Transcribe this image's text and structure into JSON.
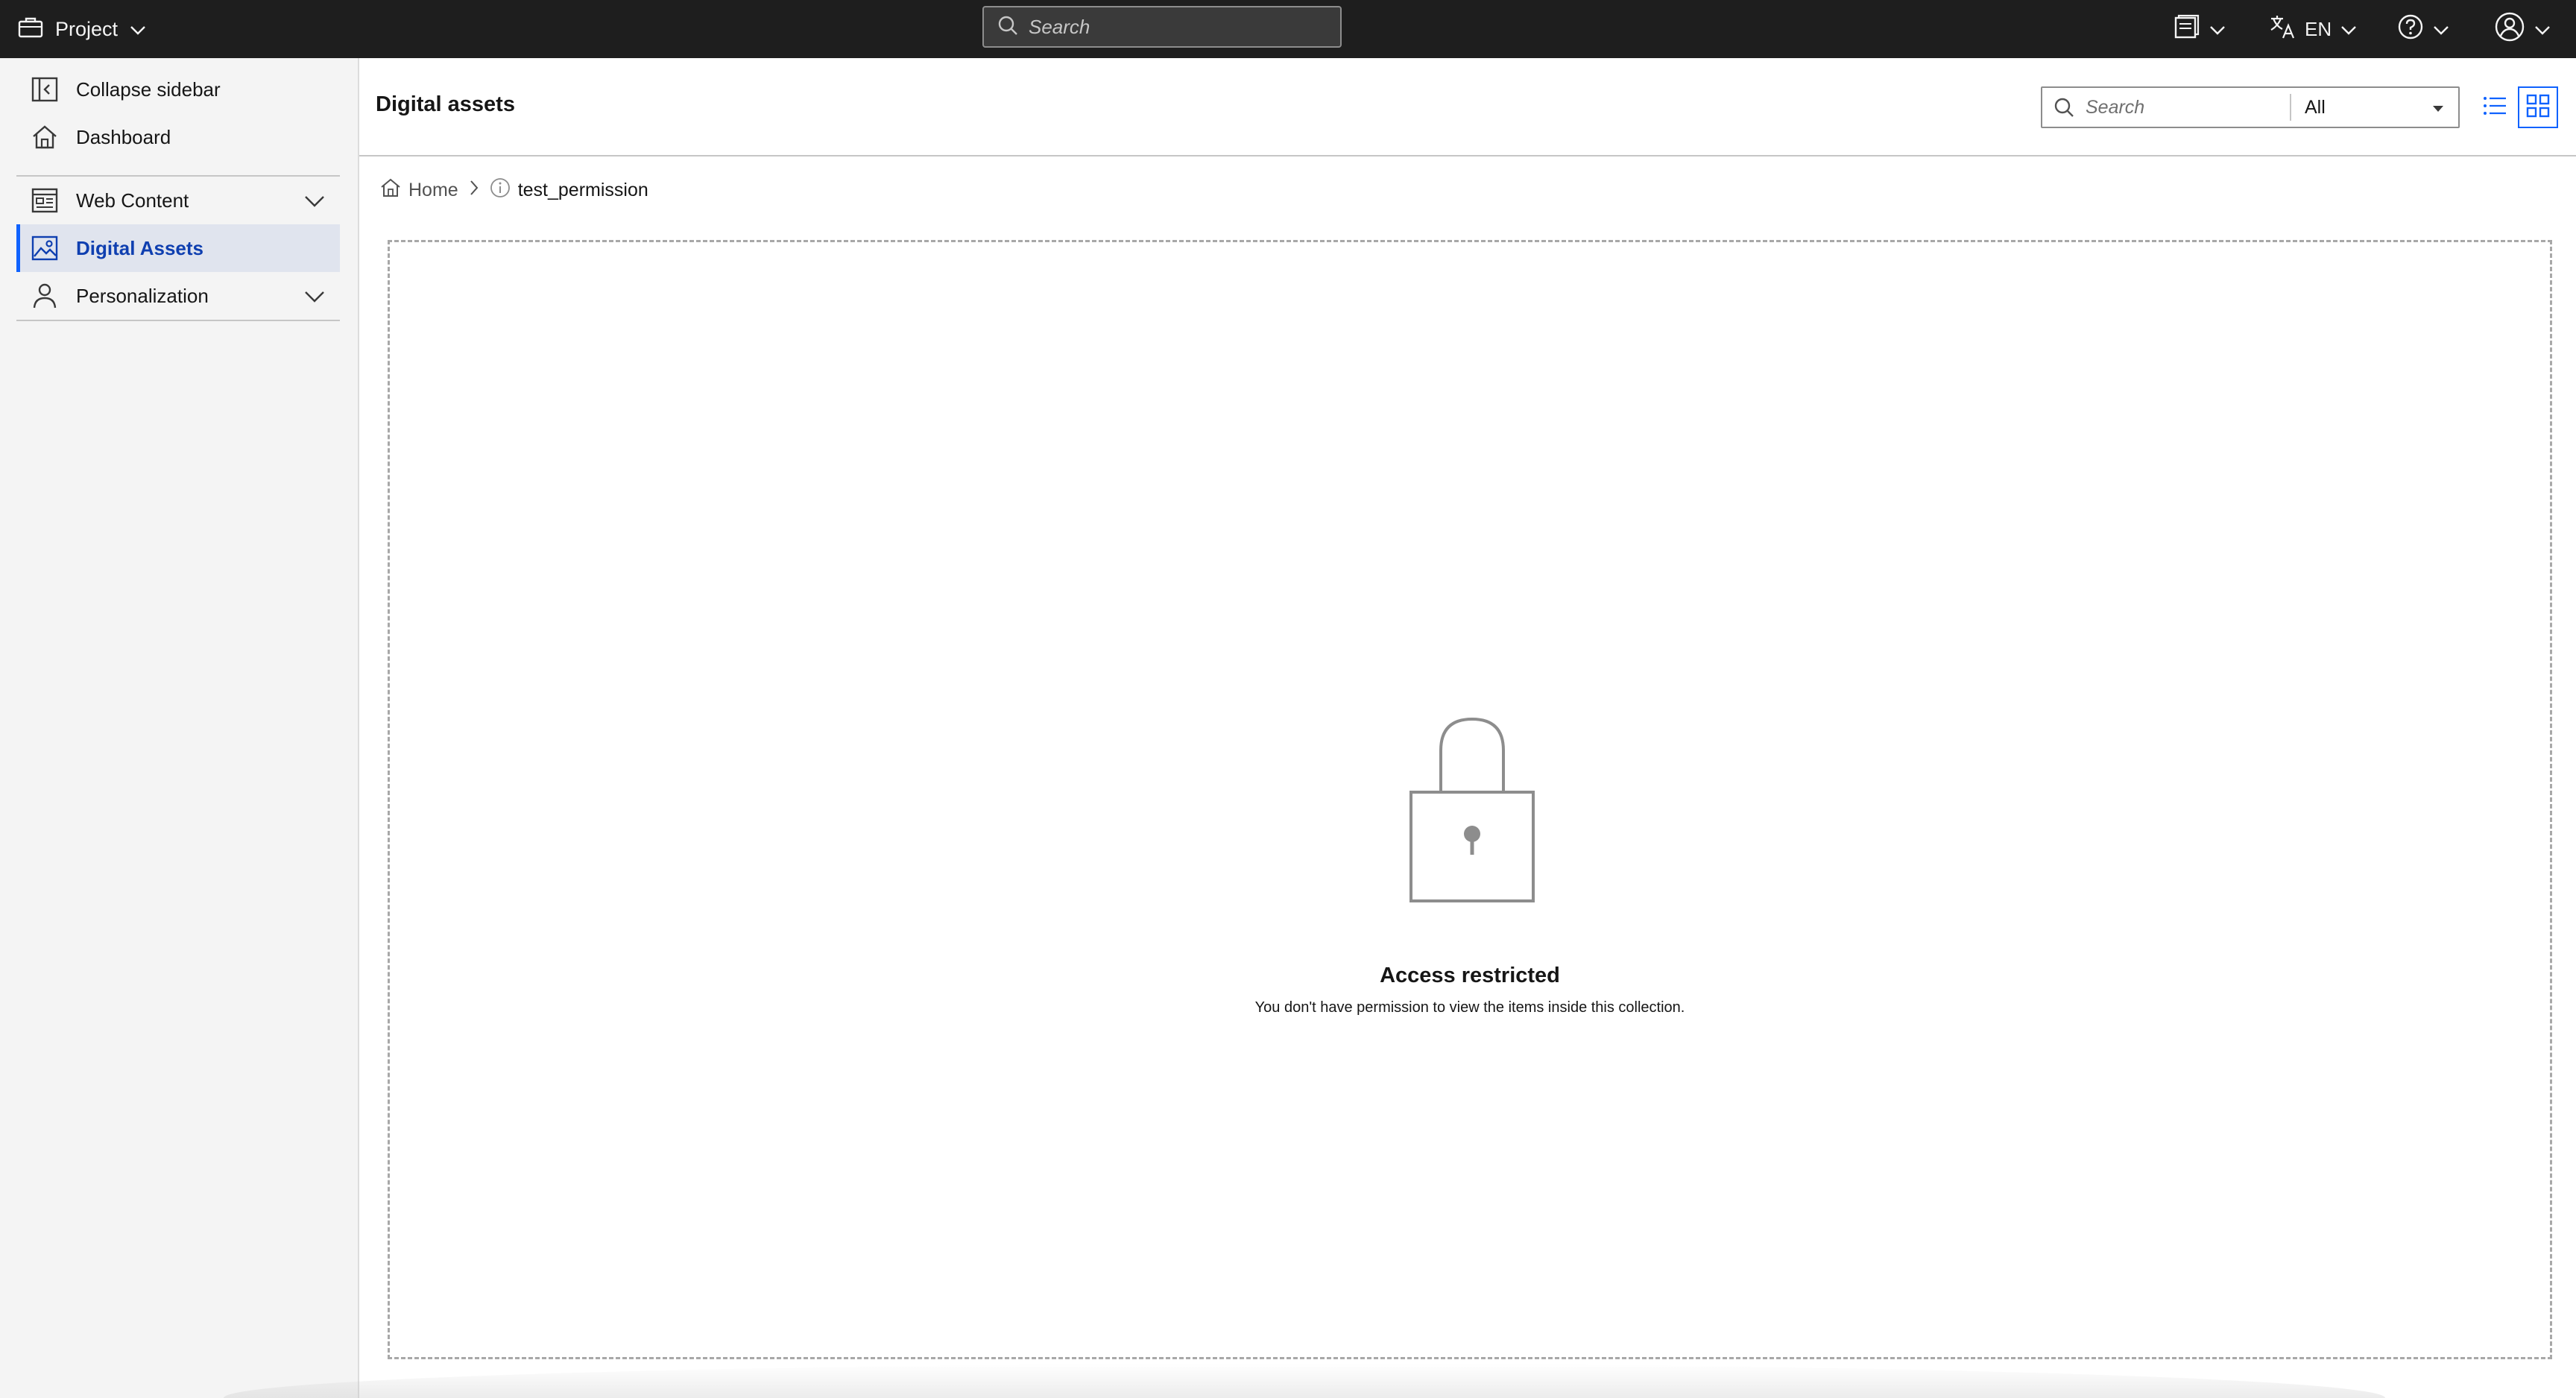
{
  "topbar": {
    "project_label": "Project",
    "search_placeholder": "Search",
    "language": "EN"
  },
  "sidebar": {
    "items": [
      {
        "label": "Collapse sidebar",
        "icon": "collapse-sidebar-icon"
      },
      {
        "label": "Dashboard",
        "icon": "home-icon"
      },
      {
        "label": "Web Content",
        "icon": "web-content-icon",
        "expandable": true
      },
      {
        "label": "Digital Assets",
        "icon": "image-icon",
        "active": true
      },
      {
        "label": "Personalization",
        "icon": "user-icon",
        "expandable": true
      }
    ]
  },
  "main": {
    "title": "Digital assets",
    "search_placeholder": "Search",
    "filter_value": "All",
    "breadcrumb": {
      "home": "Home",
      "current": "test_permission"
    },
    "empty_state": {
      "title": "Access restricted",
      "description": "You don't have permission to view the items inside this collection."
    }
  },
  "colors": {
    "topbar_bg": "#1e1e1e",
    "accent": "#0f62fe",
    "sidebar_bg": "#f4f4f4",
    "active_item_bg": "#e0e4ee"
  }
}
